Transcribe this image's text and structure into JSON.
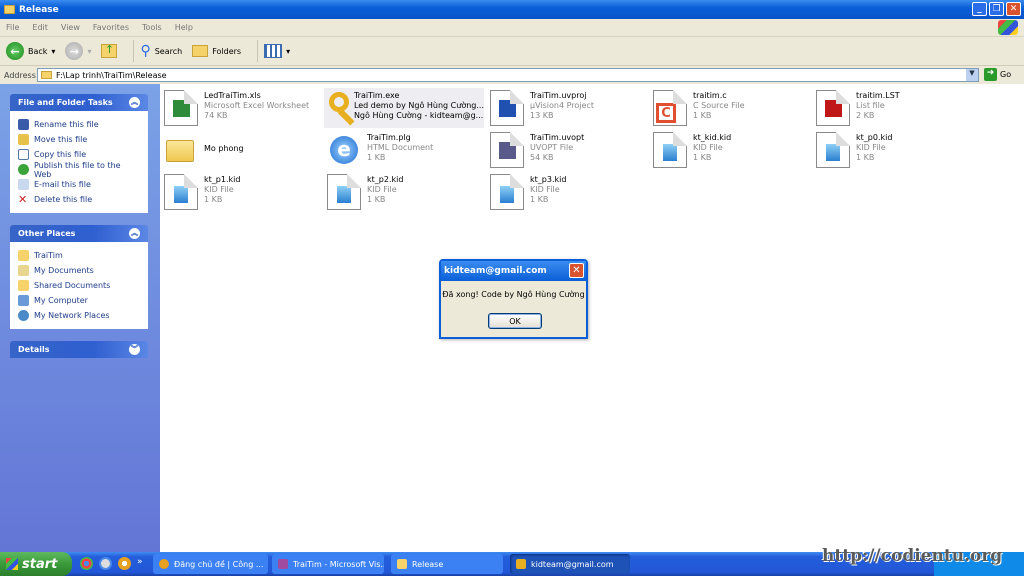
{
  "window": {
    "title": "Release"
  },
  "menu": [
    "File",
    "Edit",
    "View",
    "Favorites",
    "Tools",
    "Help"
  ],
  "toolbar": {
    "back": "Back",
    "search": "Search",
    "folders": "Folders"
  },
  "address": {
    "label": "Address",
    "value": "F:\\Lap trinh\\TraiTim\\Release",
    "go": "Go"
  },
  "sidebar": {
    "tasks": {
      "title": "File and Folder Tasks",
      "items": [
        "Rename this file",
        "Move this file",
        "Copy this file",
        "Publish this file to the Web",
        "E-mail this file",
        "Delete this file"
      ]
    },
    "places": {
      "title": "Other Places",
      "items": [
        "TraiTim",
        "My Documents",
        "Shared Documents",
        "My Computer",
        "My Network Places"
      ]
    },
    "details": {
      "title": "Details"
    }
  },
  "files": [
    {
      "name": "LedTraiTim.xls",
      "type": "Microsoft Excel Worksheet",
      "size": "74 KB",
      "icon": "excel-icon",
      "color": "#2e8b3a"
    },
    {
      "name": "TraiTim.exe",
      "type": "Led demo by Ngô Hùng Cường...",
      "size": "Ngô Hùng Cường - kidteam@g...",
      "icon": "key-icon",
      "color": "#e8b020"
    },
    {
      "name": "TraiTim.uvproj",
      "type": "µVision4 Project",
      "size": "13 KB",
      "icon": "uvision-icon",
      "color": "#2050b0"
    },
    {
      "name": "traitim.c",
      "type": "C Source File",
      "size": "1 KB",
      "icon": "c-source-icon",
      "color": "#e05030"
    },
    {
      "name": "traitim.LST",
      "type": "List file",
      "size": "2 KB",
      "icon": "cvavr-icon",
      "color": "#c01818"
    },
    {
      "name": "Mo phong",
      "type": "",
      "size": "",
      "icon": "folder-icon",
      "color": "#f5d36a"
    },
    {
      "name": "TraiTim.plg",
      "type": "HTML Document",
      "size": "1 KB",
      "icon": "ie-icon",
      "color": "#2a7fd8"
    },
    {
      "name": "TraiTim.uvopt",
      "type": "UVOPT File",
      "size": "54 KB",
      "icon": "uvopt-icon",
      "color": "#5a5a8a"
    },
    {
      "name": "kt_kid.kid",
      "type": "KID File",
      "size": "1 KB",
      "icon": "kid-file-icon",
      "color": "#2a7fd0"
    },
    {
      "name": "kt_p0.kid",
      "type": "KID File",
      "size": "1 KB",
      "icon": "kid-file-icon",
      "color": "#2a7fd0"
    },
    {
      "name": "kt_p1.kid",
      "type": "KID File",
      "size": "1 KB",
      "icon": "kid-file-icon",
      "color": "#2a7fd0"
    },
    {
      "name": "kt_p2.kid",
      "type": "KID File",
      "size": "1 KB",
      "icon": "kid-file-icon",
      "color": "#2a7fd0"
    },
    {
      "name": "kt_p3.kid",
      "type": "KID File",
      "size": "1 KB",
      "icon": "kid-file-icon",
      "color": "#2a7fd0"
    }
  ],
  "dialog": {
    "title": "kidteam@gmail.com",
    "message": "Đã xong! Code by Ngô Hùng Cường",
    "ok": "OK"
  },
  "taskbar": {
    "start": "start",
    "tasks": [
      "Đăng chủ đề | Công ...",
      "TraiTim - Microsoft Vis...",
      "Release",
      "kidteam@gmail.com"
    ]
  },
  "watermark": "http://codientu.org"
}
